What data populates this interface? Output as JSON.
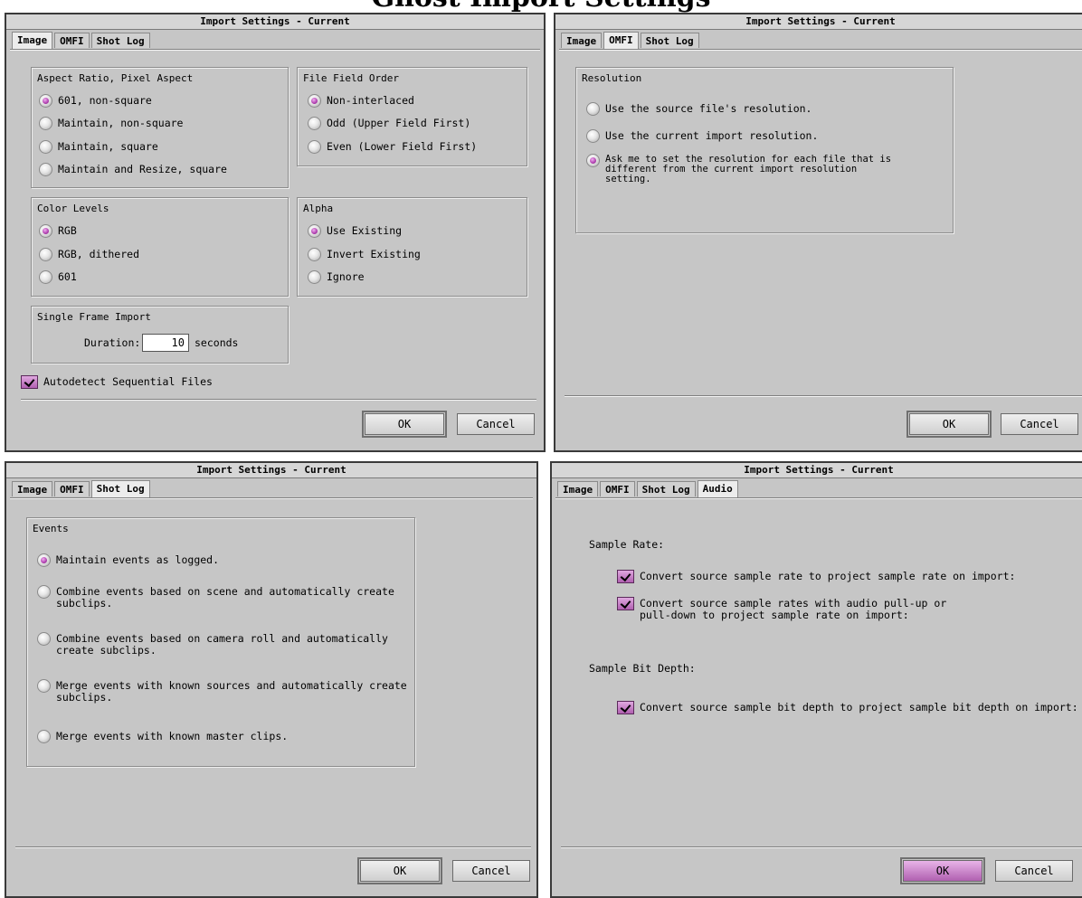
{
  "page_title": "Ghost Import Settings",
  "window_title": "Import Settings - Current",
  "tabs": {
    "image": "Image",
    "omfi": "OMFI",
    "shot_log": "Shot Log",
    "audio": "Audio"
  },
  "buttons": {
    "ok": "OK",
    "cancel": "Cancel"
  },
  "image_panel": {
    "aspect_group": "Aspect Ratio, Pixel Aspect",
    "aspect_options": [
      "601, non-square",
      "Maintain, non-square",
      "Maintain, square",
      "Maintain and Resize, square"
    ],
    "field_group": "File Field Order",
    "field_options": [
      "Non-interlaced",
      "Odd (Upper Field First)",
      "Even (Lower Field First)"
    ],
    "color_group": "Color Levels",
    "color_options": [
      "RGB",
      "RGB, dithered",
      "601"
    ],
    "alpha_group": "Alpha",
    "alpha_options": [
      "Use Existing",
      "Invert Existing",
      "Ignore"
    ],
    "single_frame_group": "Single Frame Import",
    "duration_label": "Duration:",
    "duration_value": "10",
    "duration_unit": "seconds",
    "autodetect_label": "Autodetect Sequential Files"
  },
  "omfi_panel": {
    "resolution_group": "Resolution",
    "options": [
      "Use the source file's resolution.",
      "Use the current import resolution.",
      "Ask me to set the resolution for each file that is\ndifferent from the current import resolution\nsetting."
    ]
  },
  "shotlog_panel": {
    "events_group": "Events",
    "options": [
      "Maintain events as logged.",
      "Combine events based on scene and automatically create\nsubclips.",
      "Combine events based on camera roll and automatically\ncreate subclips.",
      "Merge events with known sources and automatically create\nsubclips.",
      "Merge events with known master clips."
    ]
  },
  "audio_panel": {
    "sample_rate_label": "Sample Rate:",
    "rate_option1": "Convert source sample rate to project sample rate on import:",
    "rate_option2": "Convert source sample rates with audio pull-up or\npull-down to project sample rate on import:",
    "bit_depth_label": "Sample Bit Depth:",
    "bit_option": "Convert source sample bit depth to project sample bit depth on import:"
  }
}
